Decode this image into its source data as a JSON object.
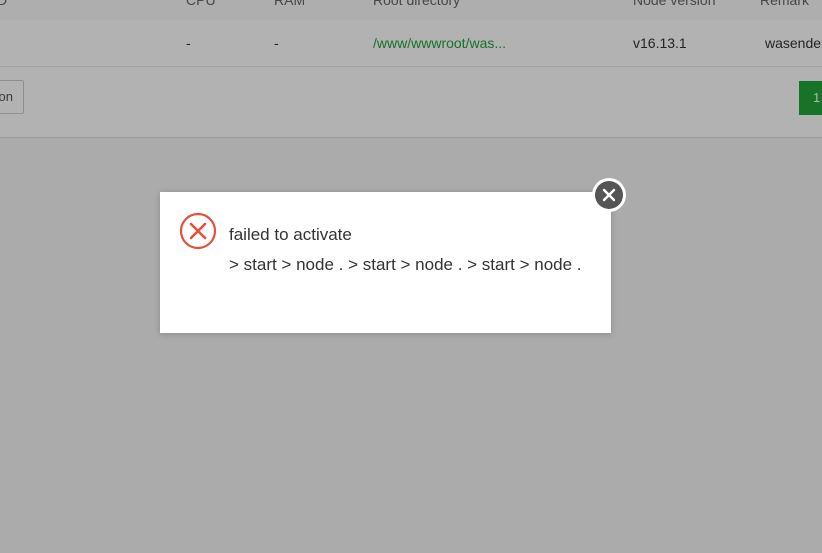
{
  "table": {
    "headers": {
      "id": "D",
      "cpu": "CPU",
      "ram": "RAM",
      "root": "Root directory",
      "node_version": "Node version",
      "remark": "Remark"
    },
    "row": {
      "cpu": "-",
      "ram": "-",
      "root": "/www/wwwroot/was...",
      "node_version": "v16.13.1",
      "remark": "wasende"
    }
  },
  "footer": {
    "button_label": "on",
    "page_number": "1"
  },
  "dialog": {
    "message_title": "failed to activate",
    "message_detail": "> start > node . > start > node . > start > node ."
  },
  "colors": {
    "accent": "#20a53a",
    "error": "#e8503a",
    "overlay": "rgba(0,0,0,0.3)"
  },
  "icons": {
    "status": "error-circle-icon",
    "close": "close-icon"
  }
}
